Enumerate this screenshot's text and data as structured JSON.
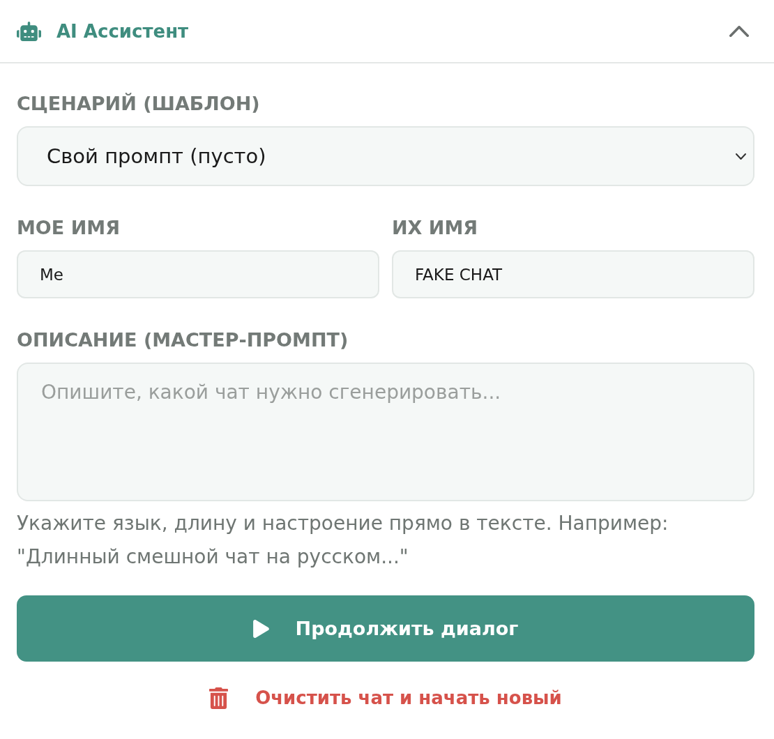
{
  "panel": {
    "title": "AI Ассистент",
    "expanded": true
  },
  "scenario": {
    "label": "СЦЕНАРИЙ (ШАБЛОН)",
    "value": "Свой промпт (пусто)"
  },
  "names": [
    {
      "label": "МОЕ ИМЯ",
      "value": "Me"
    },
    {
      "label": "ИХ ИМЯ",
      "value": "FAKE CHAT"
    }
  ],
  "description": {
    "label": "ОПИСАНИЕ (МАСТЕР-ПРОМПТ)",
    "placeholder": "Опишите, какой чат нужно сгенерировать...",
    "hint": "Укажите язык, длину и настроение прямо в тексте. Например: \"Длинный смешной чат на русском...\""
  },
  "actions": [
    {
      "kind": "primary",
      "label": "Продолжить диалог"
    },
    {
      "kind": "danger",
      "label": "Очистить чат и начать новый"
    }
  ]
}
